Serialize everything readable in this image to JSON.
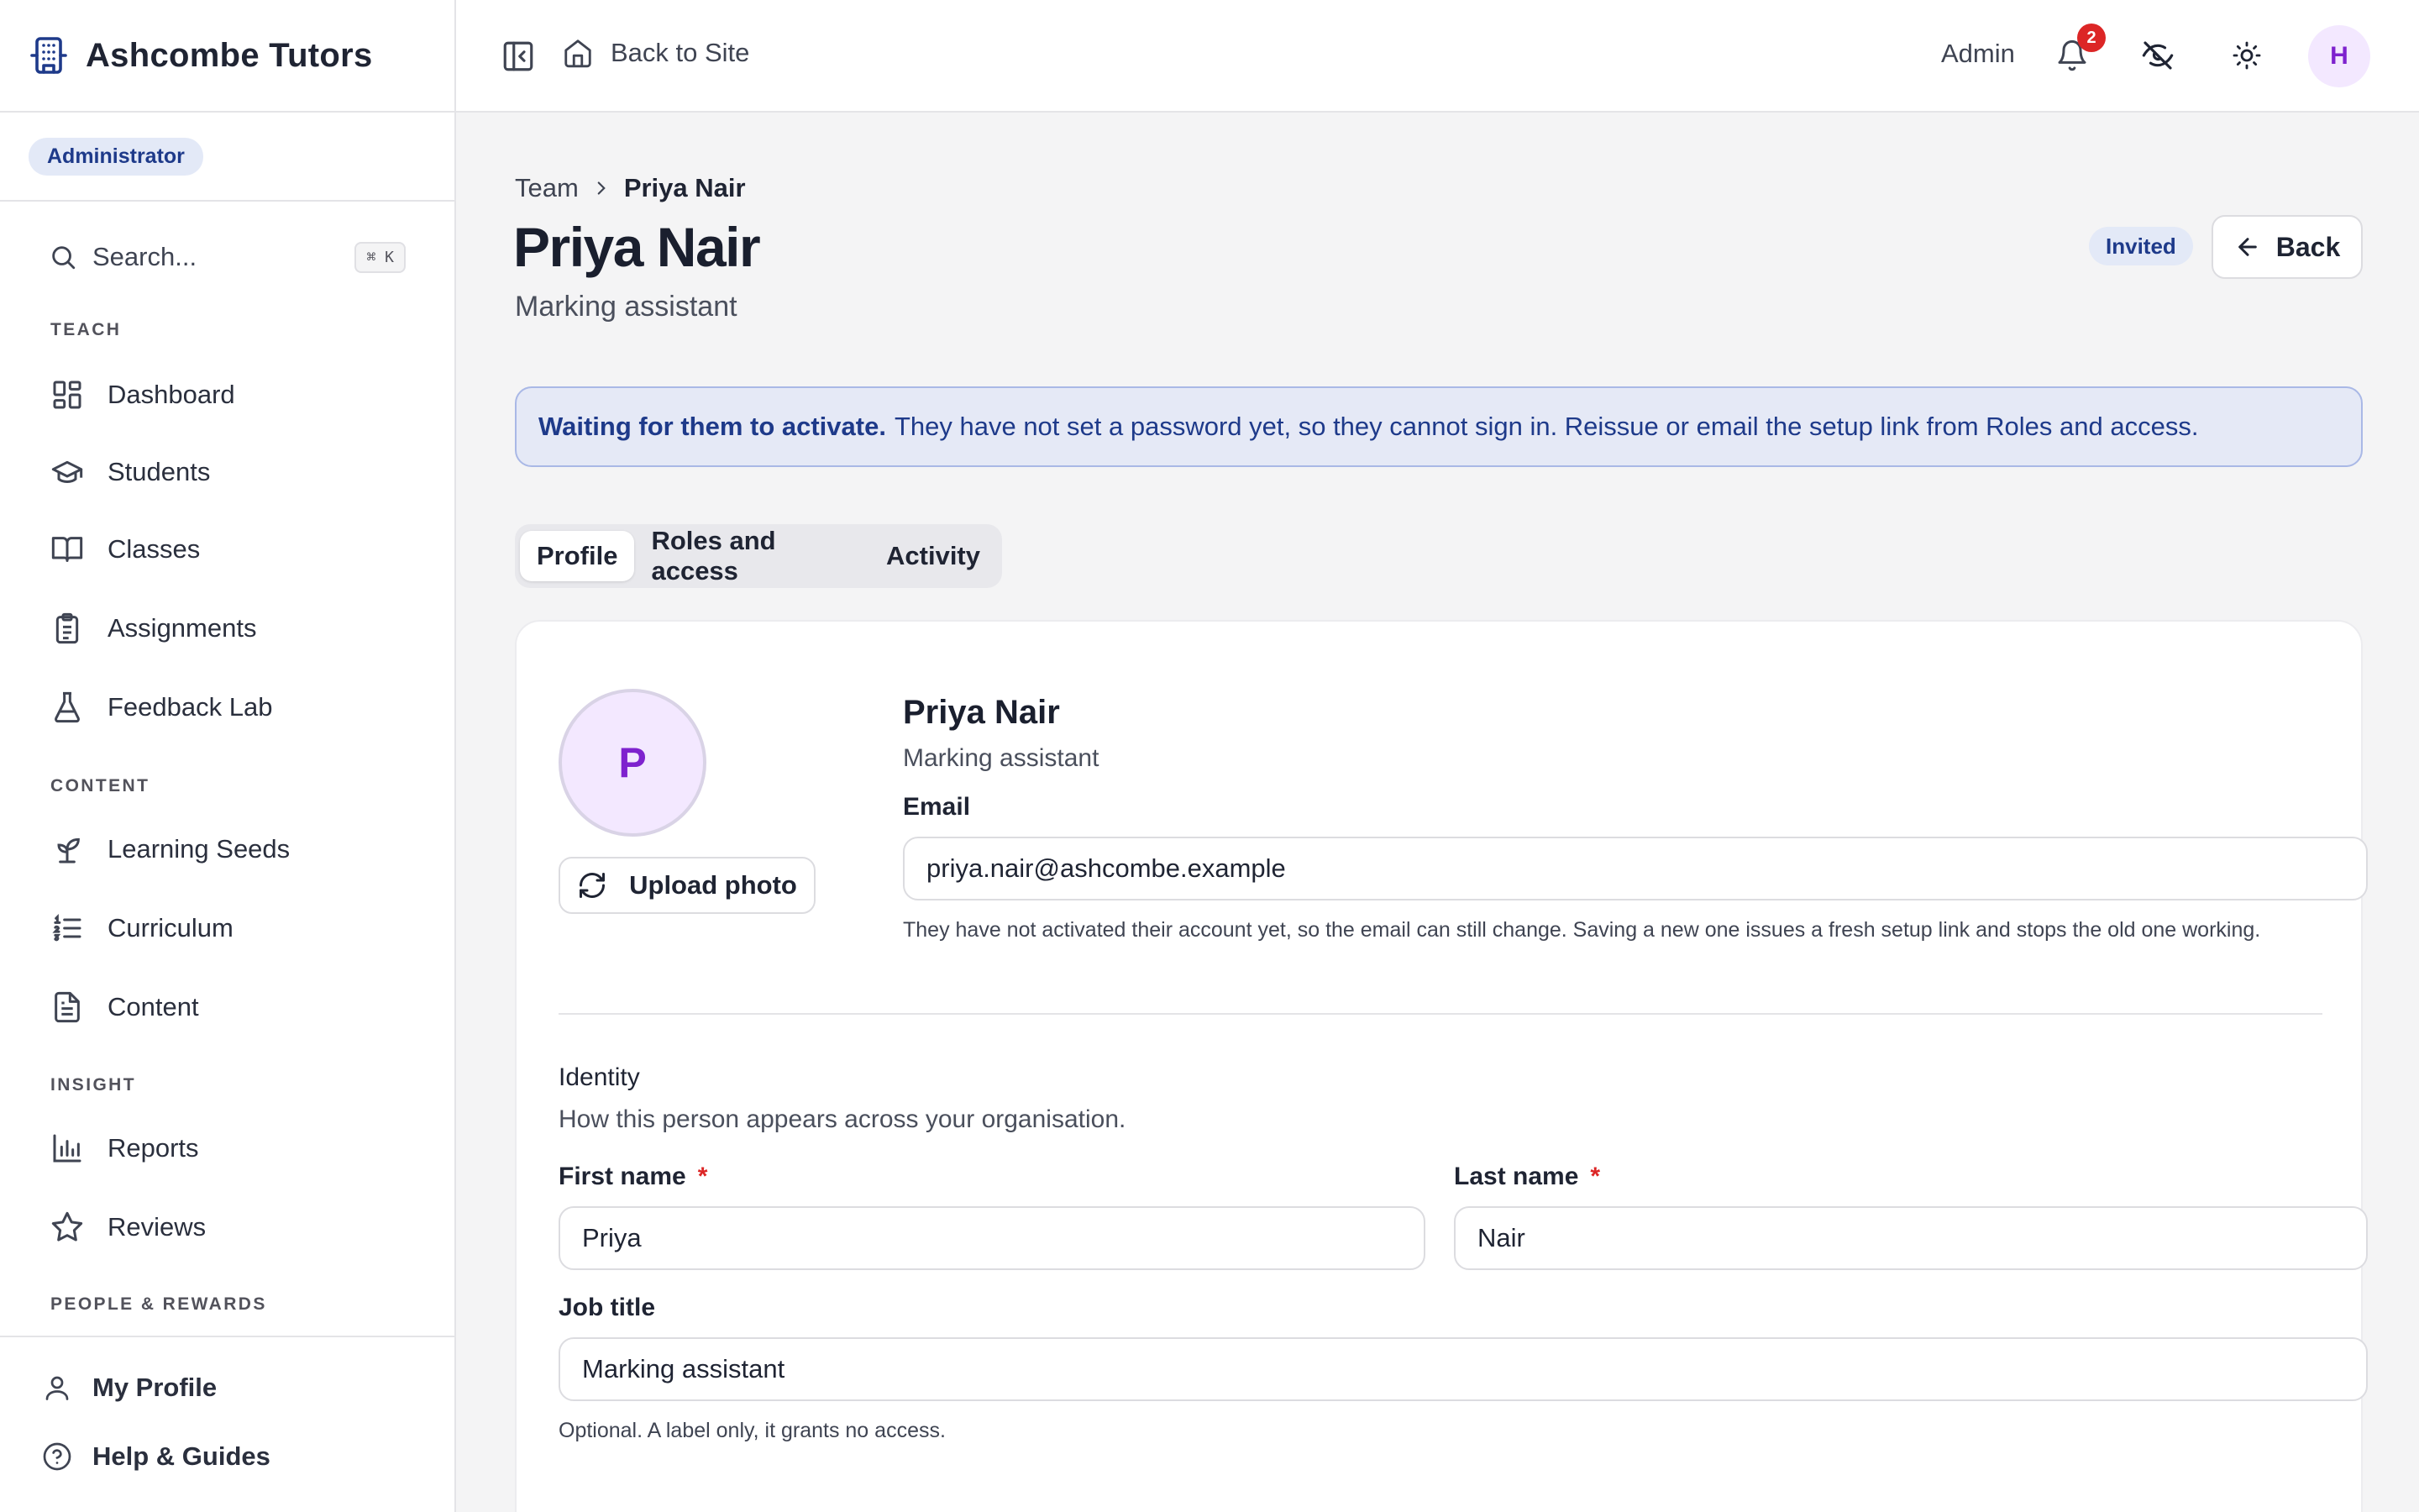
{
  "app": {
    "name": "Ashcombe Tutors",
    "role_badge": "Administrator"
  },
  "sidebar": {
    "search": {
      "placeholder": "Search...",
      "shortcut": "⌘ K"
    },
    "sections": [
      {
        "label": "TEACH",
        "items": [
          {
            "label": "Dashboard",
            "icon": "dashboard-icon"
          },
          {
            "label": "Students",
            "icon": "graduation-cap-icon"
          },
          {
            "label": "Classes",
            "icon": "book-open-icon"
          },
          {
            "label": "Assignments",
            "icon": "clipboard-icon"
          },
          {
            "label": "Feedback Lab",
            "icon": "flask-icon"
          }
        ]
      },
      {
        "label": "CONTENT",
        "items": [
          {
            "label": "Learning Seeds",
            "icon": "sprout-icon"
          },
          {
            "label": "Curriculum",
            "icon": "list-ordered-icon"
          },
          {
            "label": "Content",
            "icon": "file-text-icon"
          }
        ]
      },
      {
        "label": "INSIGHT",
        "items": [
          {
            "label": "Reports",
            "icon": "bar-chart-icon"
          },
          {
            "label": "Reviews",
            "icon": "star-icon"
          }
        ]
      },
      {
        "label": "PEOPLE & REWARDS",
        "items": []
      }
    ],
    "footer": [
      {
        "label": "My Profile",
        "icon": "user-icon"
      },
      {
        "label": "Help & Guides",
        "icon": "help-circle-icon"
      }
    ]
  },
  "topbar": {
    "back_to_site": "Back to Site",
    "mode_label": "Admin",
    "notification_count": "2",
    "avatar_initial": "H"
  },
  "page": {
    "breadcrumb": {
      "parent": "Team",
      "current": "Priya Nair"
    },
    "title": "Priya Nair",
    "subtitle": "Marking assistant",
    "status": "Invited",
    "back_label": "Back",
    "notice": {
      "strong": "Waiting for them to activate.",
      "text": "They have not set a password yet, so they cannot sign in. Reissue or email the setup link from Roles and access."
    },
    "tabs": [
      {
        "label": "Profile",
        "active": true
      },
      {
        "label": "Roles and access",
        "active": false
      },
      {
        "label": "Activity",
        "active": false
      }
    ]
  },
  "profile": {
    "avatar_initial": "P",
    "upload_label": "Upload photo",
    "name": "Priya Nair",
    "role": "Marking assistant",
    "email_label": "Email",
    "email_value": "priya.nair@ashcombe.example",
    "email_help": "They have not activated their account yet, so the email can still change. Saving a new one issues a fresh setup link and stops the old one working.",
    "identity_title": "Identity",
    "identity_desc": "How this person appears across your organisation.",
    "first_name_label": "First name",
    "first_name_value": "Priya",
    "last_name_label": "Last name",
    "last_name_value": "Nair",
    "required_mark": "*",
    "job_title_label": "Job title",
    "job_title_value": "Marking assistant",
    "job_title_help": "Optional. A label only, it grants no access."
  },
  "colors": {
    "accent": "#1e3a8a",
    "notice_bg": "#e5e9f6",
    "avatar_bg": "#f3e8ff",
    "avatar_fg": "#7e22ce",
    "badge_red": "#dc2626"
  }
}
